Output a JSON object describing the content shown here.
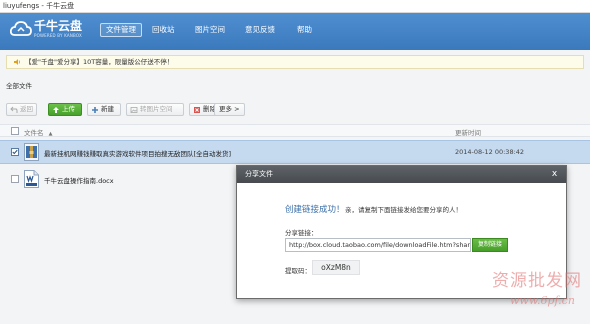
{
  "window": {
    "title": "liuyufengs - 千牛云盘"
  },
  "brand": {
    "name": "千牛云盘",
    "subtitle": "POWERED BY KANBOX"
  },
  "nav": {
    "items": [
      {
        "label": "文件管理",
        "active": true
      },
      {
        "label": "回收站",
        "active": false
      },
      {
        "label": "图片空间",
        "active": false
      },
      {
        "label": "意见反馈",
        "active": false
      },
      {
        "label": "帮助",
        "active": false
      }
    ]
  },
  "notice": {
    "text": "【爱\"千盘\"爱分享】10T容量，限量版公仔送不停！"
  },
  "breadcrumb": {
    "label": "全部文件"
  },
  "toolbar": {
    "return": "返回",
    "upload": "上传",
    "new": "新建",
    "to_image": "转图片空间",
    "delete": "删除",
    "more": "更多 >"
  },
  "table": {
    "headers": {
      "name": "文件名",
      "time": "更新时间"
    },
    "rows": [
      {
        "name": "最新挂机网赚钱赚取真实游戏软件项目拍搜无敌团队[全自动发货]",
        "time": "2014-08-12 00:38:42",
        "type": "archive",
        "selected": true
      },
      {
        "name": "千牛云盘操作指南.docx",
        "time": "",
        "type": "docx",
        "selected": false
      }
    ]
  },
  "modal": {
    "title": "分享文件",
    "close": "x",
    "success": "创建链接成功！",
    "success_sub": "亲，请复制下面链接发给您要分享的人！",
    "share_label": "分享链接：",
    "share_url": "http://box.cloud.taobao.com/file/downloadFile.htm?sharei",
    "copy_button": "复制链接",
    "code_label": "提取码：",
    "code": "oXzM8n"
  },
  "watermark": {
    "text": "资源批发网",
    "url": "www.6pf.cn"
  },
  "colors": {
    "header": "#3f7ec2",
    "accent_green": "#4fa52f",
    "selected_row": "#c5d9ef"
  }
}
